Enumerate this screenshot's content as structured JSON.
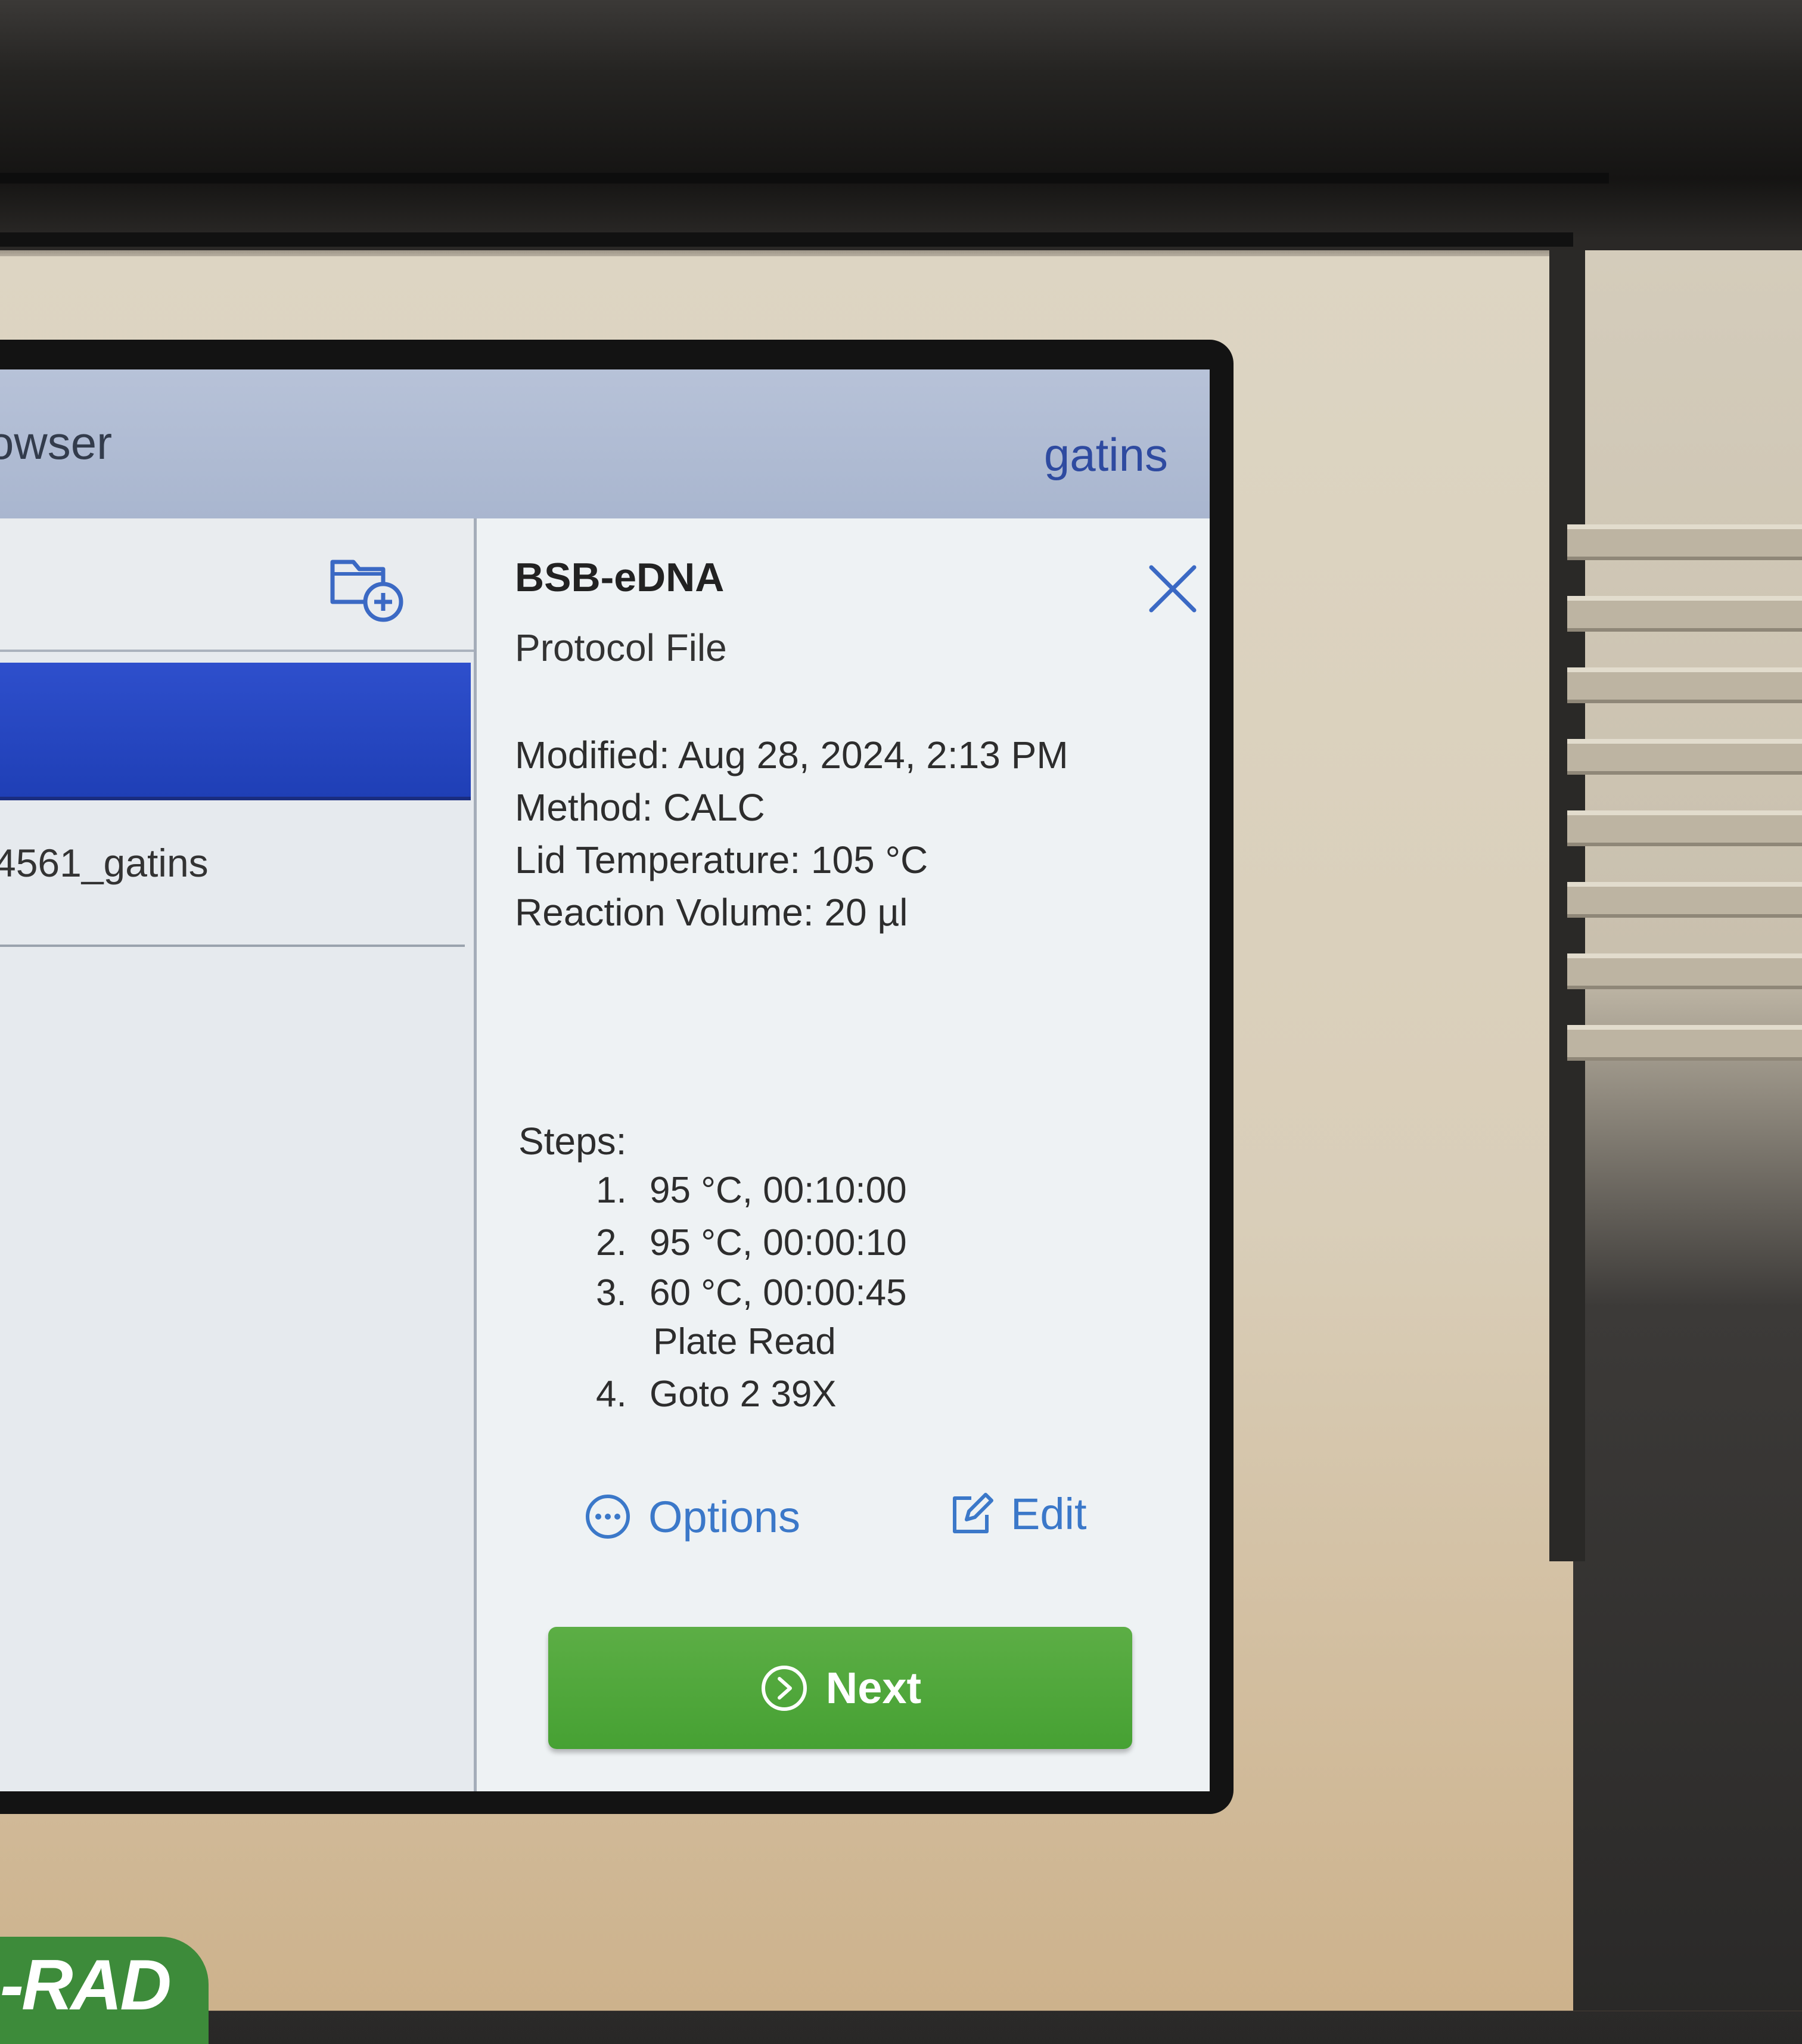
{
  "window": {
    "title": "owser",
    "user": "gatins"
  },
  "file_list": {
    "selected_item": "",
    "items": [
      "4561_gatins"
    ],
    "new_folder_icon": "folder-add-icon"
  },
  "details": {
    "name": "BSB-eDNA",
    "type": "Protocol File",
    "modified": "Modified: Aug 28, 2024, 2:13 PM",
    "method": "Method: CALC",
    "lid_temperature": "Lid Temperature: 105 °C",
    "reaction_volume": "Reaction Volume: 20 µl",
    "steps_label": "Steps:",
    "steps": [
      {
        "num": "1.",
        "text": "95 °C, 00:10:00"
      },
      {
        "num": "2.",
        "text": "95 °C, 00:00:10"
      },
      {
        "num": "3.",
        "text": "60 °C, 00:00:45",
        "sub": "Plate Read"
      },
      {
        "num": "4.",
        "text": "Goto 2 39X"
      }
    ],
    "close_icon": "close-icon"
  },
  "actions": {
    "options_label": "Options",
    "edit_label": "Edit",
    "next_label": "Next"
  },
  "brand": {
    "text": "-RAD",
    "color": "#3d8b3a"
  },
  "colors": {
    "accent_blue": "#3b78c9",
    "selection_blue": "#2e4fcc",
    "next_green": "#4ca638"
  }
}
